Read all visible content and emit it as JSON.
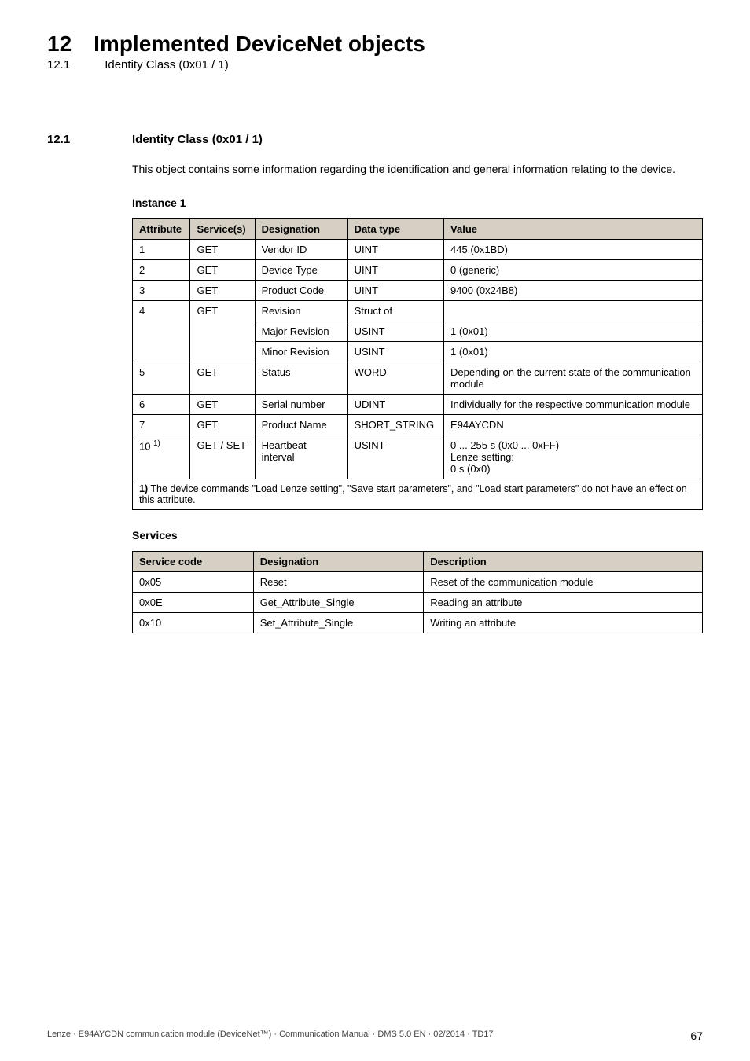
{
  "header": {
    "chapter_num": "12",
    "chapter_title": "Implemented DeviceNet objects",
    "sub_num": "12.1",
    "sub_title": "Identity Class (0x01 / 1)"
  },
  "section": {
    "num": "12.1",
    "title": "Identity Class (0x01 / 1)",
    "body": "This object contains some information regarding the identification and general information relating to the device."
  },
  "instance": {
    "heading": "Instance 1",
    "cols": {
      "attribute": "Attribute",
      "service": "Service(s)",
      "designation": "Designation",
      "datatype": "Data type",
      "value": "Value"
    },
    "rows": [
      {
        "attr": "1",
        "svc": "GET",
        "des": "Vendor ID",
        "dt": "UINT",
        "val": "445 (0x1BD)"
      },
      {
        "attr": "2",
        "svc": "GET",
        "des": "Device Type",
        "dt": "UINT",
        "val": "0 (generic)"
      },
      {
        "attr": "3",
        "svc": "GET",
        "des": "Product Code",
        "dt": "UINT",
        "val": "9400 (0x24B8)"
      },
      {
        "attr": "4",
        "svc": "GET",
        "des": "Revision",
        "dt": "Struct of",
        "val": ""
      },
      {
        "attr": "",
        "svc": "",
        "des": "Major Revision",
        "dt": "USINT",
        "val": "1 (0x01)"
      },
      {
        "attr": "",
        "svc": "",
        "des": "Minor Revision",
        "dt": "USINT",
        "val": "1 (0x01)"
      },
      {
        "attr": "5",
        "svc": "GET",
        "des": "Status",
        "dt": "WORD",
        "val": "Depending on the current state of the communication module"
      },
      {
        "attr": "6",
        "svc": "GET",
        "des": "Serial number",
        "dt": "UDINT",
        "val": "Individually for the respective communication module"
      },
      {
        "attr": "7",
        "svc": "GET",
        "des": "Product Name",
        "dt": "SHORT_STRING",
        "val": "E94AYCDN"
      },
      {
        "attr_html": "10 <sup>1)</sup>",
        "svc": "GET / SET",
        "des": "Heartbeat interval",
        "dt": "USINT",
        "val": "0 ... 255 s (0x0 ... 0xFF)\nLenze setting:\n0 s (0x0)"
      }
    ],
    "footnote_html": "<b>1)</b> The device commands \"Load Lenze setting\", \"Save start parameters\", and \"Load start parameters\" do not have an effect on this attribute."
  },
  "services": {
    "heading": "Services",
    "cols": {
      "code": "Service code",
      "designation": "Designation",
      "description": "Description"
    },
    "rows": [
      {
        "code": "0x05",
        "des": "Reset",
        "desc": "Reset of the communication module"
      },
      {
        "code": "0x0E",
        "des": "Get_Attribute_Single",
        "desc": "Reading an attribute"
      },
      {
        "code": "0x10",
        "des": "Set_Attribute_Single",
        "desc": "Writing an attribute"
      }
    ]
  },
  "footer": {
    "left": "Lenze · E94AYCDN communication module (DeviceNet™) · Communication Manual · DMS 5.0 EN · 02/2014 · TD17",
    "page": "67"
  }
}
